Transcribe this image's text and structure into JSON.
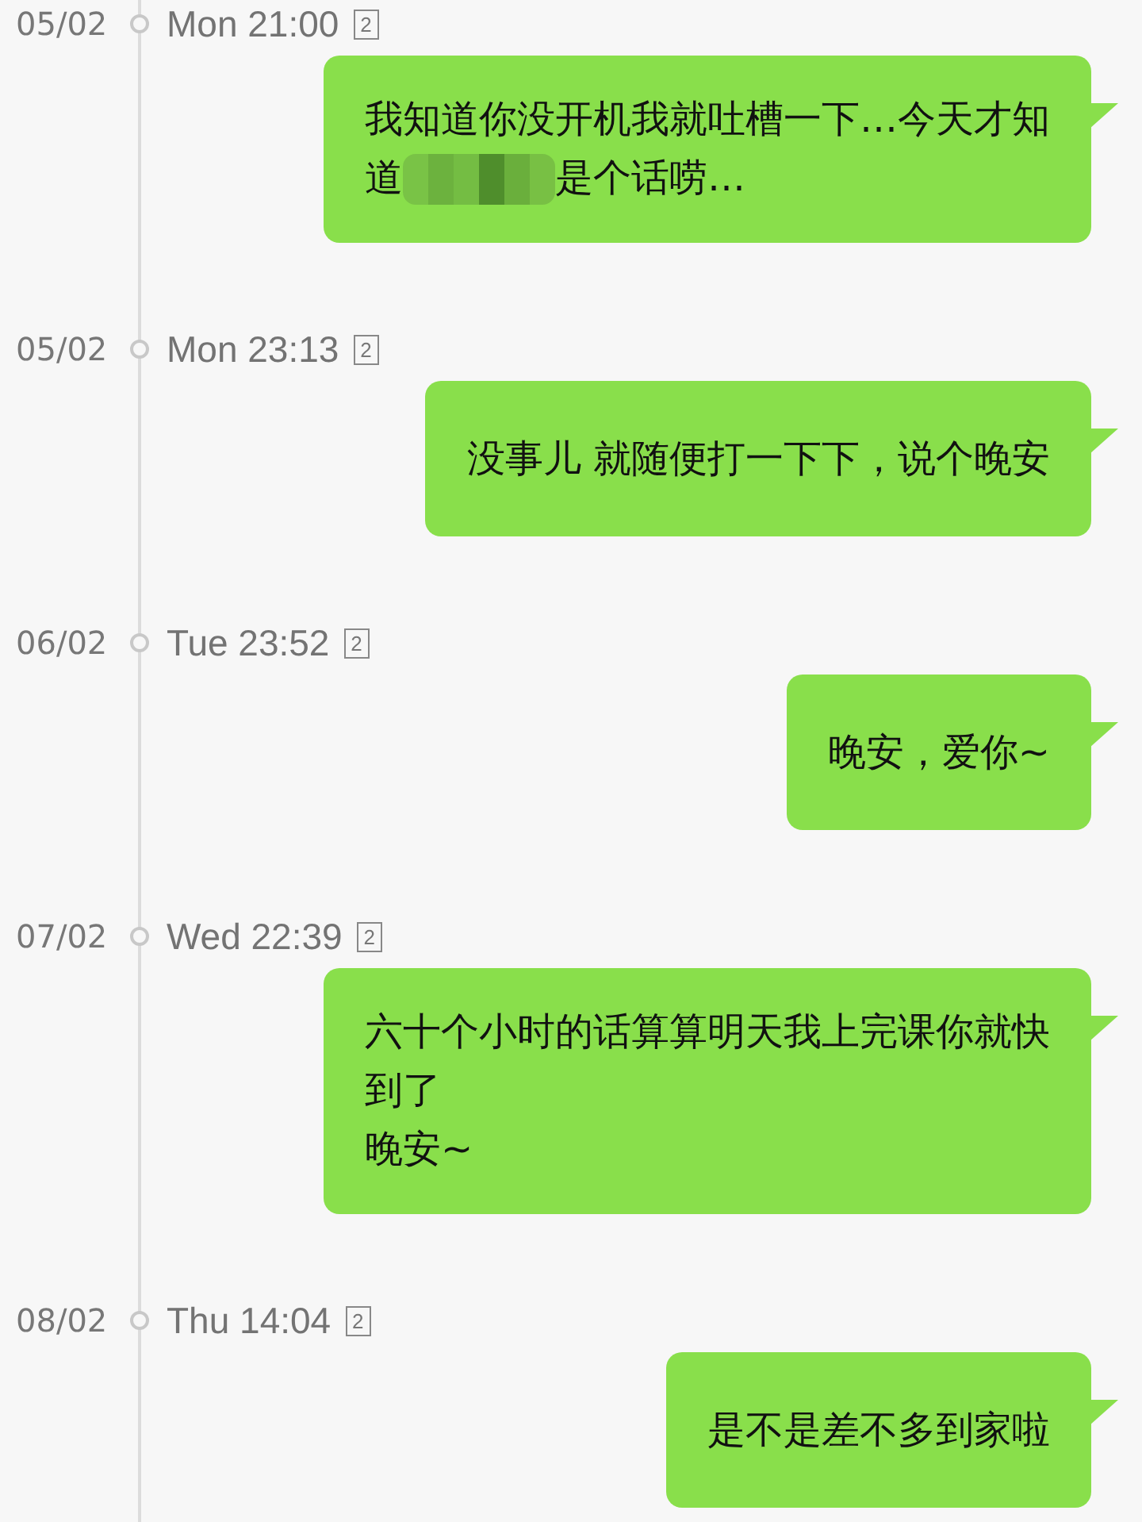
{
  "entries": [
    {
      "date": "05/02",
      "time": "Mon 21:00",
      "sim": "2",
      "message": [
        {
          "kind": "text",
          "text": "我知道你没开机我就吐槽一下…今天才知"
        },
        {
          "kind": "newline"
        },
        {
          "kind": "text",
          "text": "道"
        },
        {
          "kind": "redacted"
        },
        {
          "kind": "text",
          "text": "是个话唠…"
        }
      ]
    },
    {
      "date": "05/02",
      "time": "Mon 23:13",
      "sim": "2",
      "message": [
        {
          "kind": "text",
          "text": "没事儿 就随便打一下下，说个晚安"
        }
      ]
    },
    {
      "date": "06/02",
      "time": "Tue 23:52",
      "sim": "2",
      "message": [
        {
          "kind": "text",
          "text": "晚安，爱你~"
        }
      ]
    },
    {
      "date": "07/02",
      "time": "Wed 22:39",
      "sim": "2",
      "message": [
        {
          "kind": "text",
          "text": "六十个小时的话算算明天我上完课你就快"
        },
        {
          "kind": "newline"
        },
        {
          "kind": "text",
          "text": "到了"
        },
        {
          "kind": "newline"
        },
        {
          "kind": "text",
          "text": "晚安~"
        }
      ]
    },
    {
      "date": "08/02",
      "time": "Thu 14:04",
      "sim": "2",
      "message": [
        {
          "kind": "text",
          "text": "是不是差不多到家啦"
        }
      ]
    }
  ]
}
